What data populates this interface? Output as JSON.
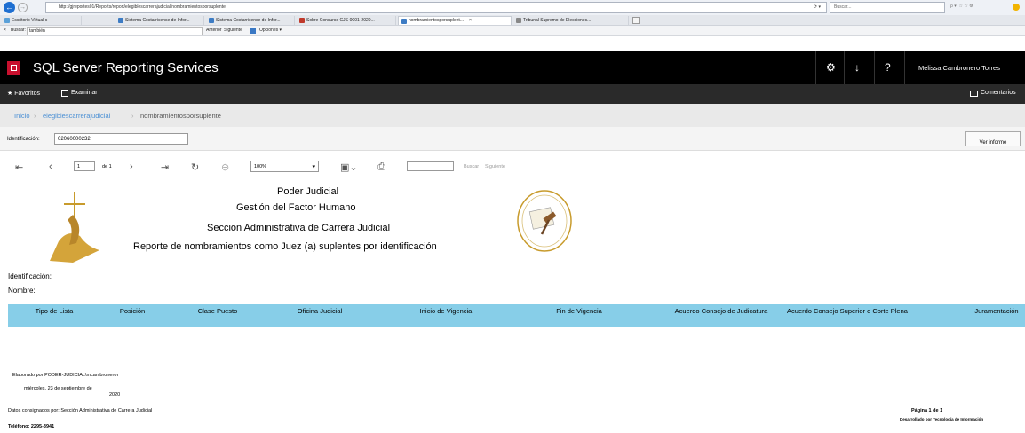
{
  "browser": {
    "address": "http://gjreportes01/Reports/report/elegiblescarrerajudicial/nombramientosporsuplente",
    "search_placeholder": "Buscar...",
    "window_controls": [
      "–",
      "□",
      "×"
    ],
    "tabs": [
      {
        "label": "Escritorio Virtual c",
        "color": "#5aa0d8"
      },
      {
        "label": "Sistema Costarricense de Infor...",
        "color": "#3d7cc4"
      },
      {
        "label": "Sistema Costarricense de Infor...",
        "color": "#3d7cc4"
      },
      {
        "label": "Sobre Concurso CJS-0001-2020...",
        "color": "#c0392b"
      },
      {
        "label": "nombramientosporsuplent...",
        "color": "#3d7cc4"
      },
      {
        "label": "Tribunal Supremo de Elecciones...",
        "color": "#888888"
      }
    ],
    "find": {
      "close": "×",
      "label": "Buscar:",
      "value": "también",
      "prev": "Anterior",
      "next": "Siguiente",
      "options": "Opciones ▾"
    }
  },
  "ssrs": {
    "title": "SQL Server Reporting Services",
    "user": "Melissa Cambronero Torres",
    "icons": {
      "settings": "⚙",
      "download": "↓",
      "help": "?"
    },
    "nav": {
      "favorites": "★ Favoritos",
      "browse": "Examinar",
      "comments": "Comentarios"
    },
    "breadcrumb": [
      "Inicio",
      "elegiblescarrerajudicial",
      "nombramientosporsuplente"
    ],
    "param_label": "Identificación:",
    "param_value": "02060000232",
    "view_report": "Ver informe",
    "toolbar": {
      "page": "1",
      "of": "de 1",
      "zoom": "100%",
      "find": "Buscar",
      "next": "Siguiente"
    },
    "accent": "#c8102e"
  },
  "report": {
    "title_lines": [
      "Poder Judicial",
      "Gestión del Factor Humano",
      "Seccion Administrativa de Carrera Judicial",
      "Reporte de nombramientos como Juez (a)  suplentes por identificación"
    ],
    "field_ident": "Identificación:",
    "field_nombre": "Nombre:",
    "columns": [
      "Tipo de Lista",
      "Posición",
      "Clase Puesto",
      "Oficina Judicial",
      "Inicio de  Vigencia",
      "Fin de Vigencia",
      "Acuerdo Consejo de Judicatura",
      "Acuerdo Consejo Superior o Corte Plena",
      "Juramentación"
    ],
    "header_color": "#87cee8",
    "footer": {
      "elaborado": "Elaborado por PODER-JUDICIAL\\mcambroneroт",
      "fecha_line1": "miércoles, 23 de septiembre de",
      "fecha_line2": "2020",
      "datos": "Datos consignados por: Sección Administrativa de Carrera Judicial",
      "telefono": "Teléfono: 2295-3941",
      "pagina": "Página 1 de 1",
      "desarrollado": "Desarrollado por Tecnología de Información"
    }
  }
}
